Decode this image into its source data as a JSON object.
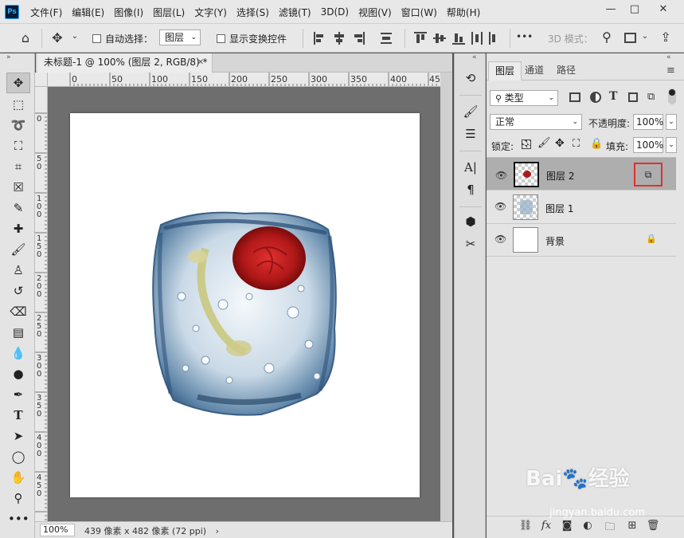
{
  "app": {
    "logo_text": "Ps"
  },
  "menu": [
    "文件(F)",
    "编辑(E)",
    "图像(I)",
    "图层(L)",
    "文字(Y)",
    "选择(S)",
    "滤镜(T)",
    "3D(D)",
    "视图(V)",
    "窗口(W)",
    "帮助(H)"
  ],
  "window_controls": {
    "minimize": "—",
    "maximize": "□",
    "close": "✕"
  },
  "options": {
    "auto_select_label": "自动选择：",
    "auto_select_value": "图层",
    "show_transform_label": "显示变换控件",
    "mode_3d_label": "3D 模式：",
    "more": "•••"
  },
  "document": {
    "tab_title": "未标题-1 @ 100% (图层 2, RGB/8) *",
    "close": "✕",
    "zoom": "100%",
    "info": "439 像素 x 482 像素 (72 ppi)",
    "info_arrow": "›"
  },
  "ruler": {
    "h_labels": [
      "0",
      "50",
      "100",
      "150",
      "200",
      "250",
      "300",
      "350",
      "400",
      "45"
    ],
    "v_labels": [
      "0",
      "5 0",
      "1 0 0",
      "1 5 0",
      "2 0 0",
      "2 5 0",
      "3 0 0",
      "3 5 0",
      "4 0 0",
      "4 5 0"
    ]
  },
  "panel": {
    "tabs": [
      "图层",
      "通道",
      "路径"
    ],
    "kind_filter": "类型",
    "blend_mode": "正常",
    "opacity_label": "不透明度:",
    "opacity_value": "100%",
    "lock_label": "锁定:",
    "fill_label": "填充:",
    "fill_value": "100%",
    "layers": [
      {
        "name": "图层 2",
        "selected": true
      },
      {
        "name": "图层 1",
        "selected": false
      },
      {
        "name": "背景",
        "selected": false
      }
    ]
  },
  "colors": {
    "highlight_box": "#e03030",
    "rose": "#b01818",
    "ice": "#5f86a8"
  },
  "watermark": {
    "brand": "Bai🐾经验",
    "url": "jingyan.baidu.com"
  }
}
